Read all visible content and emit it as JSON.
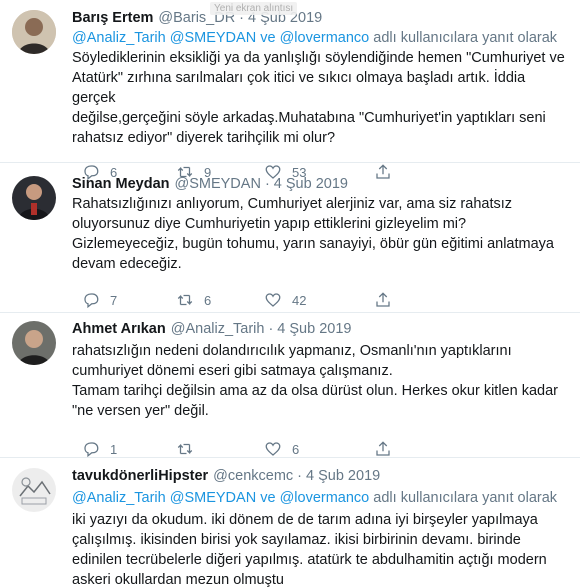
{
  "tooltip": "Yeni ekran alıntısı",
  "tweets": [
    {
      "name": "Barış Ertem",
      "handle": "@Baris_DR",
      "time": "4 Şub 2019",
      "reply_to": {
        "mentions": [
          "@Analiz_Tarih",
          "@SMEYDAN",
          "@lovermanco"
        ],
        "connector": "ve",
        "suffix": "adlı kullanıcılara yanıt olarak"
      },
      "text": [
        "Söylediklerinin eksikliği ya da yanlışlığı söylendiğinde hemen \"Cumhuriyet ve",
        "Atatürk\" zırhına sarılmaları çok itici ve sıkıcı olmaya başladı artık. İddia gerçek",
        "değilse,gerçeğini söyle arkadaş.Muhatabına \"Cumhuriyet'in yaptıkları seni",
        "rahatsız ediyor\" diyerek tarihçilik mi olur?"
      ],
      "replies": "6",
      "retweets": "9",
      "likes": "53",
      "avatar_colors": [
        "#5b4a3c",
        "#c9b6a0"
      ]
    },
    {
      "name": "Sinan Meydan",
      "handle": "@SMEYDAN",
      "time": "4 Şub 2019",
      "text": [
        "Rahatsızlığınızı anlıyorum, Cumhuriyet alerjiniz var, ama siz rahatsız",
        "oluyorsunuz diye Cumhuriyetin yapıp ettiklerini gizleyelim mi?",
        "Gizlemeyeceğiz, bugün tohumu, yarın sanayiyi, öbür gün eğitimi anlatmaya",
        "devam edeceğiz."
      ],
      "replies": "7",
      "retweets": "6",
      "likes": "42",
      "avatar_colors": [
        "#2a2a30",
        "#b0302a"
      ]
    },
    {
      "name": "Ahmet Arıkan",
      "handle": "@Analiz_Tarih",
      "time": "4 Şub 2019",
      "text": [
        "rahatsızlığın nedeni dolandırıcılık yapmanız, Osmanlı'nın yaptıklarını",
        "cumhuriyet dönemi eseri gibi satmaya çalışmanız.",
        "Tamam tarihçi değilsin ama az da olsa dürüst olun. Herkes okur kitlen kadar",
        "\"ne versen yer\" değil."
      ],
      "replies": "1",
      "retweets": "",
      "likes": "6",
      "avatar_colors": [
        "#6a6a66",
        "#d8c9b8"
      ]
    },
    {
      "name": "tavukdönerliHipster",
      "handle": "@cenkcemc",
      "time": "4 Şub 2019",
      "reply_to": {
        "mentions": [
          "@Analiz_Tarih",
          "@SMEYDAN",
          "@lovermanco"
        ],
        "connector": "ve",
        "suffix": "adlı kullanıcılara yanıt olarak"
      },
      "text": [
        "iki yazıyı da okudum. iki dönem de de tarım adına iyi birşeyler yapılmaya",
        "çalışılmış. ikisinden birisi yok sayılamaz. ikisi birbirinin devamı. birinde",
        "edinilen tecrübelerle diğeri yapılmış. atatürk te abdulhamitin açtığı modern",
        "askeri okullardan mezun olmuştu"
      ],
      "avatar_colors": [
        "#e8e8e8",
        "#9aa0a6"
      ]
    }
  ]
}
